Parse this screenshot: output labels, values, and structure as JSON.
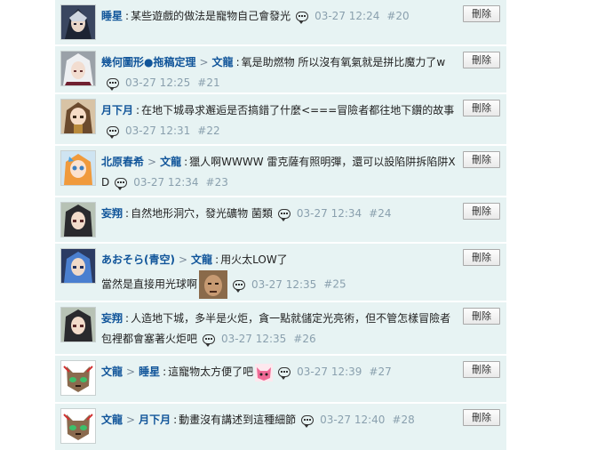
{
  "ui": {
    "delete_label": "刪除"
  },
  "comments": [
    {
      "user": "睡星",
      "reply_to": "",
      "text": "某些遊戲的做法是寵物自己會發光",
      "time": "03-27 12:24",
      "floor": "#20",
      "avatar": "dark-armored-character-avatar"
    },
    {
      "user": "幾何圖形●拖稿定理",
      "reply_to": "文龍",
      "text": "氧是助燃物 所以沒有氧氣就是拼比魔力了w",
      "time": "03-27 12:25",
      "floor": "#21",
      "avatar": "white-haired-character-avatar"
    },
    {
      "user": "月下月",
      "reply_to": "",
      "text": "在地下城尋求邂逅是否搞錯了什麼<===冒險者都往地下鑽的故事",
      "time": "03-27 12:31",
      "floor": "#22",
      "avatar": "brown-haired-girl-avatar"
    },
    {
      "user": "北原春希",
      "reply_to": "文龍",
      "text": "獵人啊WWWW 雷克薩有照明彈，還可以設陷阱拆陷阱XD",
      "time": "03-27 12:34",
      "floor": "#23",
      "avatar": "orange-haired-girl-avatar"
    },
    {
      "user": "妄翔",
      "reply_to": "",
      "text": "自然地形洞穴，發光礦物 菌類",
      "time": "03-27 12:34",
      "floor": "#24",
      "avatar": "dark-haired-girl-avatar"
    },
    {
      "user": "あおそら(青空)",
      "reply_to": "文龍",
      "text": "用火太LOW了\n當然是直接用光球啊",
      "time": "03-27 12:35",
      "floor": "#25",
      "avatar": "blue-haired-character-avatar"
    },
    {
      "user": "妄翔",
      "reply_to": "",
      "text": "人造地下城，多半是火炬，貪一點就儲定光亮術，但不管怎樣冒險者包裡都會塞著火炬吧",
      "time": "03-27 12:35",
      "floor": "#26",
      "avatar": "dark-haired-girl-avatar"
    },
    {
      "user": "文龍",
      "reply_to": "睡星",
      "text": "這寵物太方便了吧",
      "time": "03-27 12:39",
      "floor": "#27",
      "avatar": "cat-mascot-avatar"
    },
    {
      "user": "文龍",
      "reply_to": "月下月",
      "text": "動畫沒有講述到這種細節",
      "time": "03-27 12:40",
      "floor": "#28",
      "avatar": "cat-mascot-avatar"
    }
  ]
}
